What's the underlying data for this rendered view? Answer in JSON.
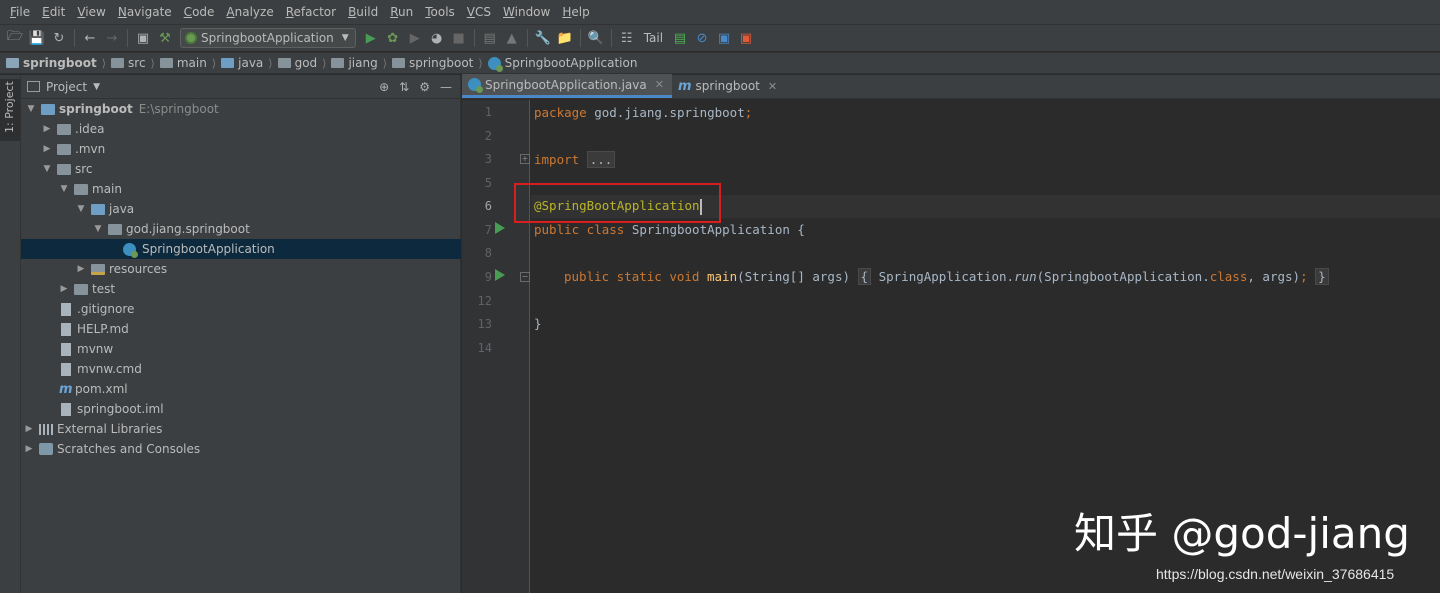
{
  "menu": [
    "File",
    "Edit",
    "View",
    "Navigate",
    "Code",
    "Analyze",
    "Refactor",
    "Build",
    "Run",
    "Tools",
    "VCS",
    "Window",
    "Help"
  ],
  "toolbar": {
    "run_config": "SpringbootApplication",
    "tail_label": "Tail",
    "icons": [
      "open-icon",
      "save-icon",
      "sync-icon",
      "back-icon",
      "forward-icon",
      "build-icon",
      "hammer-icon",
      "run-icon",
      "debug-icon",
      "coverage-icon",
      "profile-icon",
      "stop-icon",
      "project-structure-icon",
      "settings-icon",
      "search-icon",
      "vcs-icon",
      "monitor-icon",
      "no-entry-icon",
      "translate-icon",
      "google-icon"
    ]
  },
  "breadcrumb": [
    {
      "label": "springboot",
      "type": "root"
    },
    {
      "label": "src",
      "type": "folder"
    },
    {
      "label": "main",
      "type": "folder"
    },
    {
      "label": "java",
      "type": "folder"
    },
    {
      "label": "god",
      "type": "folder"
    },
    {
      "label": "jiang",
      "type": "folder"
    },
    {
      "label": "springboot",
      "type": "folder"
    },
    {
      "label": "SpringbootApplication",
      "type": "class"
    }
  ],
  "left_stripe": {
    "label": "1: Project"
  },
  "project": {
    "title": "Project",
    "tree": [
      {
        "label": "springboot",
        "extra": "E:\\springboot"
      },
      {
        "label": ".idea"
      },
      {
        "label": ".mvn"
      },
      {
        "label": "src"
      },
      {
        "label": "main"
      },
      {
        "label": "java"
      },
      {
        "label": "god.jiang.springboot"
      },
      {
        "label": "SpringbootApplication"
      },
      {
        "label": "resources"
      },
      {
        "label": "test"
      },
      {
        "label": ".gitignore"
      },
      {
        "label": "HELP.md"
      },
      {
        "label": "mvnw"
      },
      {
        "label": "mvnw.cmd"
      },
      {
        "label": "pom.xml"
      },
      {
        "label": "springboot.iml"
      },
      {
        "label": "External Libraries"
      },
      {
        "label": "Scratches and Consoles"
      }
    ]
  },
  "editor": {
    "tabs": [
      {
        "label": "SpringbootApplication.java",
        "active": true
      },
      {
        "label": "springboot",
        "active": false
      }
    ],
    "line_numbers": [
      "1",
      "2",
      "3",
      "5",
      "6",
      "7",
      "8",
      "9",
      "12",
      "13",
      "14"
    ],
    "current_line": "6",
    "code": {
      "l1_kw": "package",
      "l1_rest": " god.jiang.springboot",
      "l1_semi": ";",
      "l3_kw": "import",
      "l3_fold": "...",
      "l6_ann": "@SpringBootApplication",
      "l7_kw": "public class",
      "l7_rest": " SpringbootApplication {",
      "l9_kw": "public static void",
      "l9_fn": "main",
      "l9_params": "(String[] args)",
      "l9_open": "{",
      "l9_call_a": "SpringApplication.",
      "l9_call_fn": "run",
      "l9_call_b": "(SpringbootApplication.",
      "l9_class_kw": "class",
      "l9_call_c": ", args)",
      "l9_semi": ";",
      "l9_close": "}",
      "l13": "}"
    }
  },
  "watermark": "知乎 @god-jiang",
  "csdn_url": "https://blog.csdn.net/weixin_37686415",
  "colors": {
    "highlight_border": "#d81e1e",
    "keyword": "#cc7832",
    "annotation": "#bbb529",
    "method": "#ffc66d",
    "selection": "#0d293e"
  }
}
